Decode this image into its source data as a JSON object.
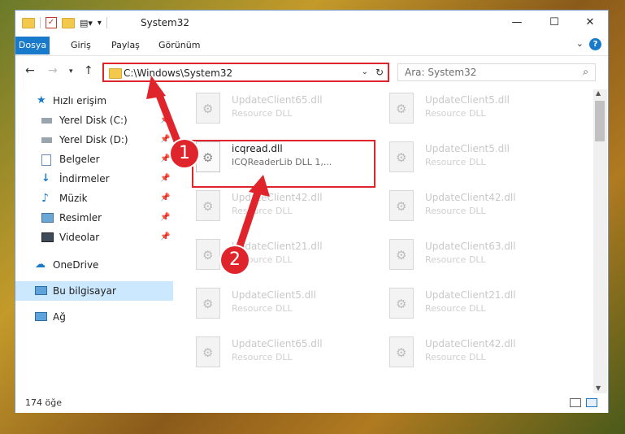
{
  "window": {
    "title": "System32"
  },
  "ribbon": {
    "tabs": [
      "Dosya",
      "Giriş",
      "Paylaş",
      "Görünüm"
    ]
  },
  "nav": {
    "address": "C:\\Windows\\System32",
    "search_placeholder": "Ara: System32"
  },
  "sidebar": {
    "items": [
      {
        "label": "Hızlı erişim",
        "icon": "star-icon"
      },
      {
        "label": "Yerel Disk (C:)",
        "icon": "drive-icon",
        "pinned": true
      },
      {
        "label": "Yerel Disk (D:)",
        "icon": "drive-icon",
        "pinned": true
      },
      {
        "label": "Belgeler",
        "icon": "documents-icon",
        "pinned": true
      },
      {
        "label": "İndirmeler",
        "icon": "downloads-icon",
        "pinned": true
      },
      {
        "label": "Müzik",
        "icon": "music-icon",
        "pinned": true
      },
      {
        "label": "Resimler",
        "icon": "pictures-icon",
        "pinned": true
      },
      {
        "label": "Videolar",
        "icon": "videos-icon",
        "pinned": true
      },
      {
        "label": "OneDrive",
        "icon": "cloud-icon"
      },
      {
        "label": "Bu bilgisayar",
        "icon": "computer-icon",
        "selected": true
      },
      {
        "label": "Ağ",
        "icon": "network-icon"
      }
    ]
  },
  "files": [
    {
      "name": "UpdateClient65.dll",
      "desc": "Resource DLL"
    },
    {
      "name": "UpdateClient5.dll",
      "desc": "Resource DLL"
    },
    {
      "name": "icqread.dll",
      "desc": "ICQReaderLib DLL 1,...",
      "active": true
    },
    {
      "name": "UpdateClient5.dll",
      "desc": "Resource DLL"
    },
    {
      "name": "UpdateClient42.dll",
      "desc": "Resource DLL"
    },
    {
      "name": "UpdateClient42.dll",
      "desc": "Resource DLL"
    },
    {
      "name": "UpdateClient21.dll",
      "desc": "Resource DLL"
    },
    {
      "name": "UpdateClient63.dll",
      "desc": "Resource DLL"
    },
    {
      "name": "UpdateClient5.dll",
      "desc": "Resource DLL"
    },
    {
      "name": "UpdateClient21.dll",
      "desc": "Resource DLL"
    },
    {
      "name": "UpdateClient65.dll",
      "desc": "Resource DLL"
    },
    {
      "name": "UpdateClient42.dll",
      "desc": "Resource DLL"
    }
  ],
  "status": {
    "count": "174 öğe"
  },
  "annotations": {
    "step1": "1",
    "step2": "2",
    "color": "#e0242b"
  }
}
